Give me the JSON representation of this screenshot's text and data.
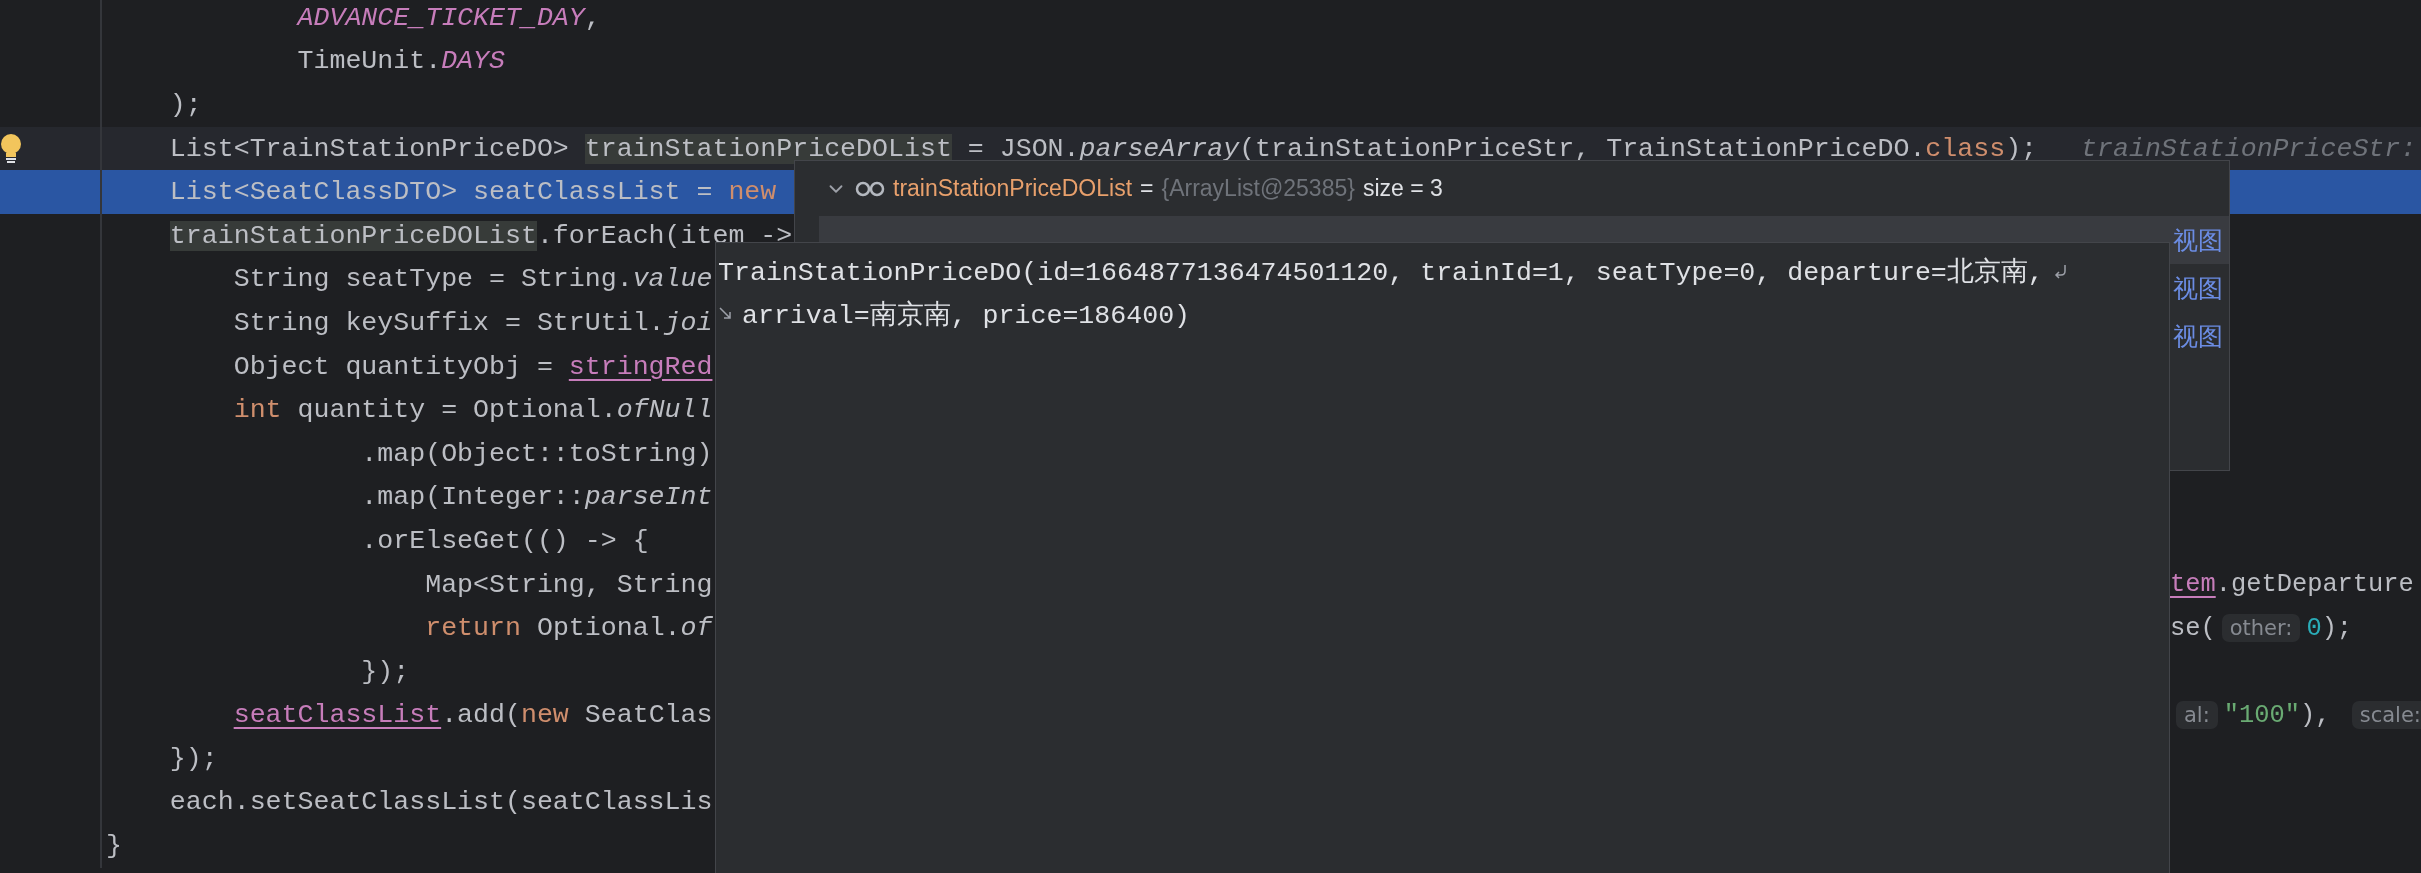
{
  "editor": {
    "lines": [
      {
        "selected": false,
        "current": false,
        "intention_bulb": false,
        "left": [
          {
            "kind": "const",
            "text": "            ADVANCE_TICKET_DAY"
          },
          {
            "kind": "plain",
            "text": ","
          }
        ]
      },
      {
        "selected": false,
        "current": false,
        "intention_bulb": false,
        "left": [
          {
            "kind": "plain",
            "text": "            TimeUnit."
          },
          {
            "kind": "const",
            "text": "DAYS"
          }
        ]
      },
      {
        "selected": false,
        "current": false,
        "intention_bulb": false,
        "left": [
          {
            "kind": "plain",
            "text": "    );"
          }
        ]
      },
      {
        "selected": false,
        "current": true,
        "intention_bulb": true,
        "left": [
          {
            "kind": "plain",
            "text": "    List<TrainStationPriceDO> "
          },
          {
            "kind": "usage",
            "text": "trainStationPriceDOList"
          },
          {
            "kind": "plain",
            "text": " = JSON."
          },
          {
            "kind": "static",
            "text": "parseArray"
          },
          {
            "kind": "plain",
            "text": "(trainStationPriceStr, TrainStationPriceDO."
          },
          {
            "kind": "keyword",
            "text": "class"
          },
          {
            "kind": "plain",
            "text": ");"
          },
          {
            "kind": "ghost",
            "text": "trainStationPriceStr:"
          }
        ]
      },
      {
        "selected": true,
        "current": false,
        "intention_bulb": false,
        "left": [
          {
            "kind": "plain",
            "text": "    List<SeatClassDTO> seatClassList = "
          },
          {
            "kind": "keyword",
            "text": "new"
          }
        ]
      },
      {
        "selected": false,
        "current": false,
        "intention_bulb": false,
        "left": [
          {
            "kind": "usage",
            "text": "    trainStationPriceDOList"
          },
          {
            "kind": "plain",
            "text": ".forEach(item ->"
          }
        ]
      },
      {
        "selected": false,
        "current": false,
        "intention_bulb": false,
        "left": [
          {
            "kind": "plain",
            "text": "        String seatType = String."
          },
          {
            "kind": "static",
            "text": "value"
          }
        ]
      },
      {
        "selected": false,
        "current": false,
        "intention_bulb": false,
        "left": [
          {
            "kind": "plain",
            "text": "        String keySuffix = StrUtil."
          },
          {
            "kind": "static",
            "text": "joi"
          }
        ]
      },
      {
        "selected": false,
        "current": false,
        "intention_bulb": false,
        "left": [
          {
            "kind": "plain",
            "text": "        Object quantityObj = "
          },
          {
            "kind": "field",
            "text": "stringRed"
          }
        ]
      },
      {
        "selected": false,
        "current": false,
        "intention_bulb": false,
        "left": [
          {
            "kind": "keyword",
            "text": "        int"
          },
          {
            "kind": "plain",
            "text": " quantity = Optional."
          },
          {
            "kind": "static",
            "text": "ofNull"
          }
        ]
      },
      {
        "selected": false,
        "current": false,
        "intention_bulb": false,
        "left": [
          {
            "kind": "plain",
            "text": "                .map(Object::toString)"
          }
        ]
      },
      {
        "selected": false,
        "current": false,
        "intention_bulb": false,
        "left": [
          {
            "kind": "plain",
            "text": "                .map(Integer::"
          },
          {
            "kind": "static",
            "text": "parseInt"
          }
        ]
      },
      {
        "selected": false,
        "current": false,
        "intention_bulb": false,
        "left": [
          {
            "kind": "plain",
            "text": "                .orElseGet(() -> {"
          }
        ]
      },
      {
        "selected": false,
        "current": false,
        "intention_bulb": false,
        "left": [
          {
            "kind": "plain",
            "text": "                    Map<String, String"
          }
        ],
        "right": [
          {
            "kind": "field",
            "text": "tem"
          },
          {
            "kind": "plain",
            "text": ".getDeparture"
          }
        ]
      },
      {
        "selected": false,
        "current": false,
        "intention_bulb": false,
        "left": [
          {
            "kind": "keyword",
            "text": "                    return"
          },
          {
            "kind": "plain",
            "text": " Optional."
          },
          {
            "kind": "static",
            "text": "of"
          }
        ],
        "right": [
          {
            "kind": "plain",
            "text": "se("
          },
          {
            "kind": "hint",
            "text": "other:"
          },
          {
            "kind": "number",
            "text": "0"
          },
          {
            "kind": "plain",
            "text": ");"
          }
        ]
      },
      {
        "selected": false,
        "current": false,
        "intention_bulb": false,
        "left": [
          {
            "kind": "plain",
            "text": "                });"
          }
        ]
      },
      {
        "selected": false,
        "current": false,
        "intention_bulb": false,
        "left": [
          {
            "kind": "field",
            "text": "        seatClassList"
          },
          {
            "kind": "plain",
            "text": ".add("
          },
          {
            "kind": "keyword",
            "text": "new"
          },
          {
            "kind": "plain",
            "text": " SeatClas"
          }
        ],
        "right": [
          {
            "kind": "hint",
            "text": "al:"
          },
          {
            "kind": "string",
            "text": "\"100\""
          },
          {
            "kind": "plain",
            "text": "), "
          },
          {
            "kind": "hint",
            "text": "scale:"
          }
        ]
      },
      {
        "selected": false,
        "current": false,
        "intention_bulb": false,
        "left": [
          {
            "kind": "plain",
            "text": "    });"
          }
        ]
      },
      {
        "selected": false,
        "current": false,
        "intention_bulb": false,
        "left": [
          {
            "kind": "plain",
            "text": "    each.setSeatClassList(seatClassLis"
          }
        ]
      },
      {
        "selected": false,
        "current": false,
        "intention_bulb": false,
        "left": [
          {
            "kind": "plain",
            "text": "}"
          }
        ]
      }
    ]
  },
  "debug_popup": {
    "header": {
      "expanded": true,
      "name": "trainStationPriceDOList",
      "equals": "=",
      "type": "{ArrayList@25385}",
      "size": "size = 3"
    },
    "rows": [
      {
        "selected": true,
        "link": "视图"
      },
      {
        "selected": false,
        "link": "视图"
      },
      {
        "selected": false,
        "link": "视图"
      }
    ]
  },
  "value_tooltip": {
    "lines": [
      "TrainStationPriceDO(id=1664877136474501120, trainId=1, seatType=0, departure=北京南,",
      "arrival=南京南, price=186400)"
    ]
  }
}
